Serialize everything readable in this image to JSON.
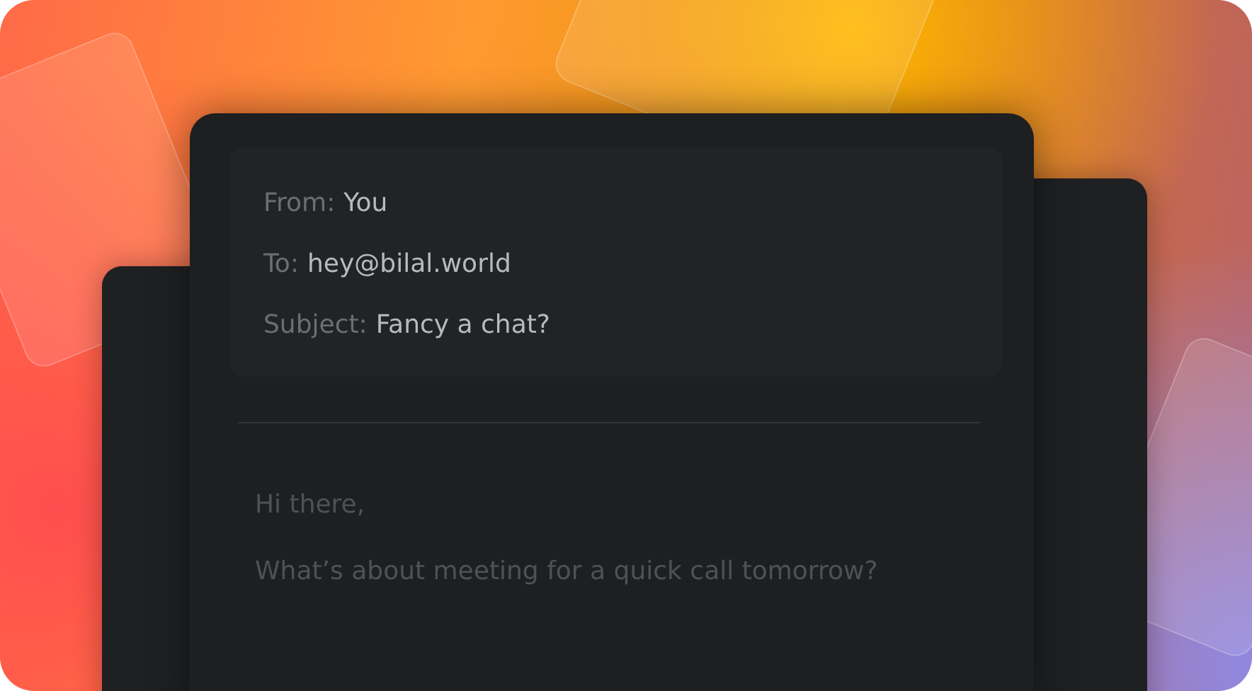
{
  "email": {
    "fields": [
      {
        "label": "From:",
        "value": "You"
      },
      {
        "label": "To:",
        "value": "hey@bilal.world"
      },
      {
        "label": "Subject:",
        "value": "Fancy a chat?"
      }
    ],
    "body": [
      "Hi there,",
      "What’s about meeting for a quick call tomorrow?"
    ]
  }
}
